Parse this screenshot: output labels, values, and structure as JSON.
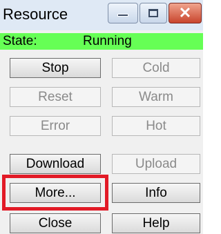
{
  "window": {
    "title": "Resource"
  },
  "status": {
    "label": "State:",
    "value": "Running"
  },
  "buttons": {
    "stop": "Stop",
    "cold": "Cold",
    "reset": "Reset",
    "warm": "Warm",
    "error": "Error",
    "hot": "Hot",
    "download": "Download",
    "upload": "Upload",
    "more": "More...",
    "info": "Info",
    "close": "Close",
    "help": "Help"
  },
  "colors": {
    "status_bg": "#66ff55",
    "highlight": "#e21a26"
  }
}
